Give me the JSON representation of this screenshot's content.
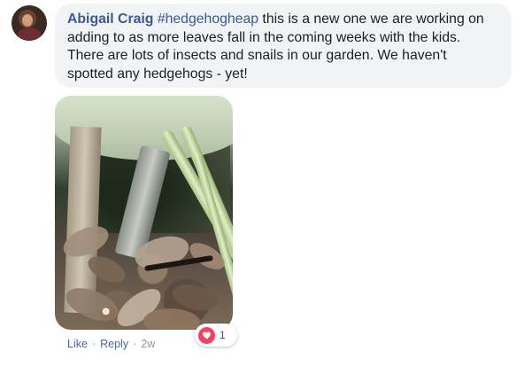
{
  "comment": {
    "author": "Abigail Craig",
    "hashtag": "#hedgehogheap",
    "text_line_1": " this is a new one we are working on",
    "text_line_2": "adding to as more leaves fall in the coming weeks with the kids.",
    "text_line_3": "There are lots of insects and snails in our garden. We haven't",
    "text_line_4": "spotted any hedgehogs - yet!"
  },
  "actions": {
    "like": "Like",
    "separator_1": "·",
    "reply": "Reply",
    "separator_2": "·",
    "time": "2w"
  },
  "reactions": {
    "count": "1",
    "icon": "heart-icon"
  },
  "colors": {
    "author_link": "#385898",
    "action_link": "#4b67a1",
    "bubble_bg": "#f2f3f5",
    "reaction_red": "#f3425f"
  }
}
